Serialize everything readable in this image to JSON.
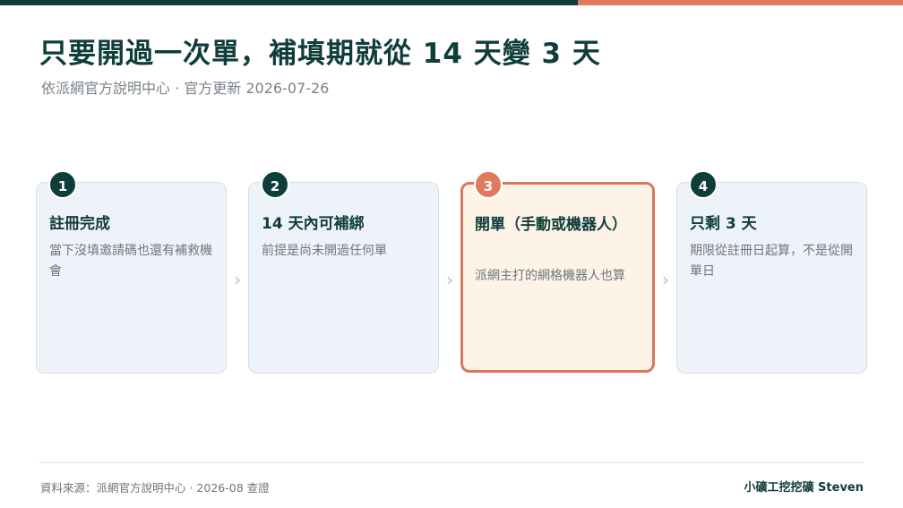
{
  "header": {
    "title": "只要開過一次單，補填期就從 14 天變 3 天",
    "subtitle": "依派網官方說明中心 · 官方更新 2026-07-26"
  },
  "steps": [
    {
      "number": "1",
      "title": "註冊完成",
      "desc": "當下沒填邀請碼也還有補救機會"
    },
    {
      "number": "2",
      "title": "14 天內可補綁",
      "desc": "前提是尚未開過任何單"
    },
    {
      "number": "3",
      "title": "開單（手動或機器人）",
      "desc": "派網主打的網格機器人也算"
    },
    {
      "number": "4",
      "title": "只剩 3 天",
      "desc": "期限從註冊日起算，不是從開單日"
    }
  ],
  "chevron_glyph": "›",
  "footer": {
    "source": "資料來源：派網官方說明中心 · 2026-08 查證",
    "author": "小礦工挖挖礦 Steven"
  },
  "colors": {
    "brand_dark": "#0f3d3a",
    "accent": "#e07a5f",
    "card_bg": "#eef3fa",
    "highlight_bg": "#fdf3e7"
  }
}
